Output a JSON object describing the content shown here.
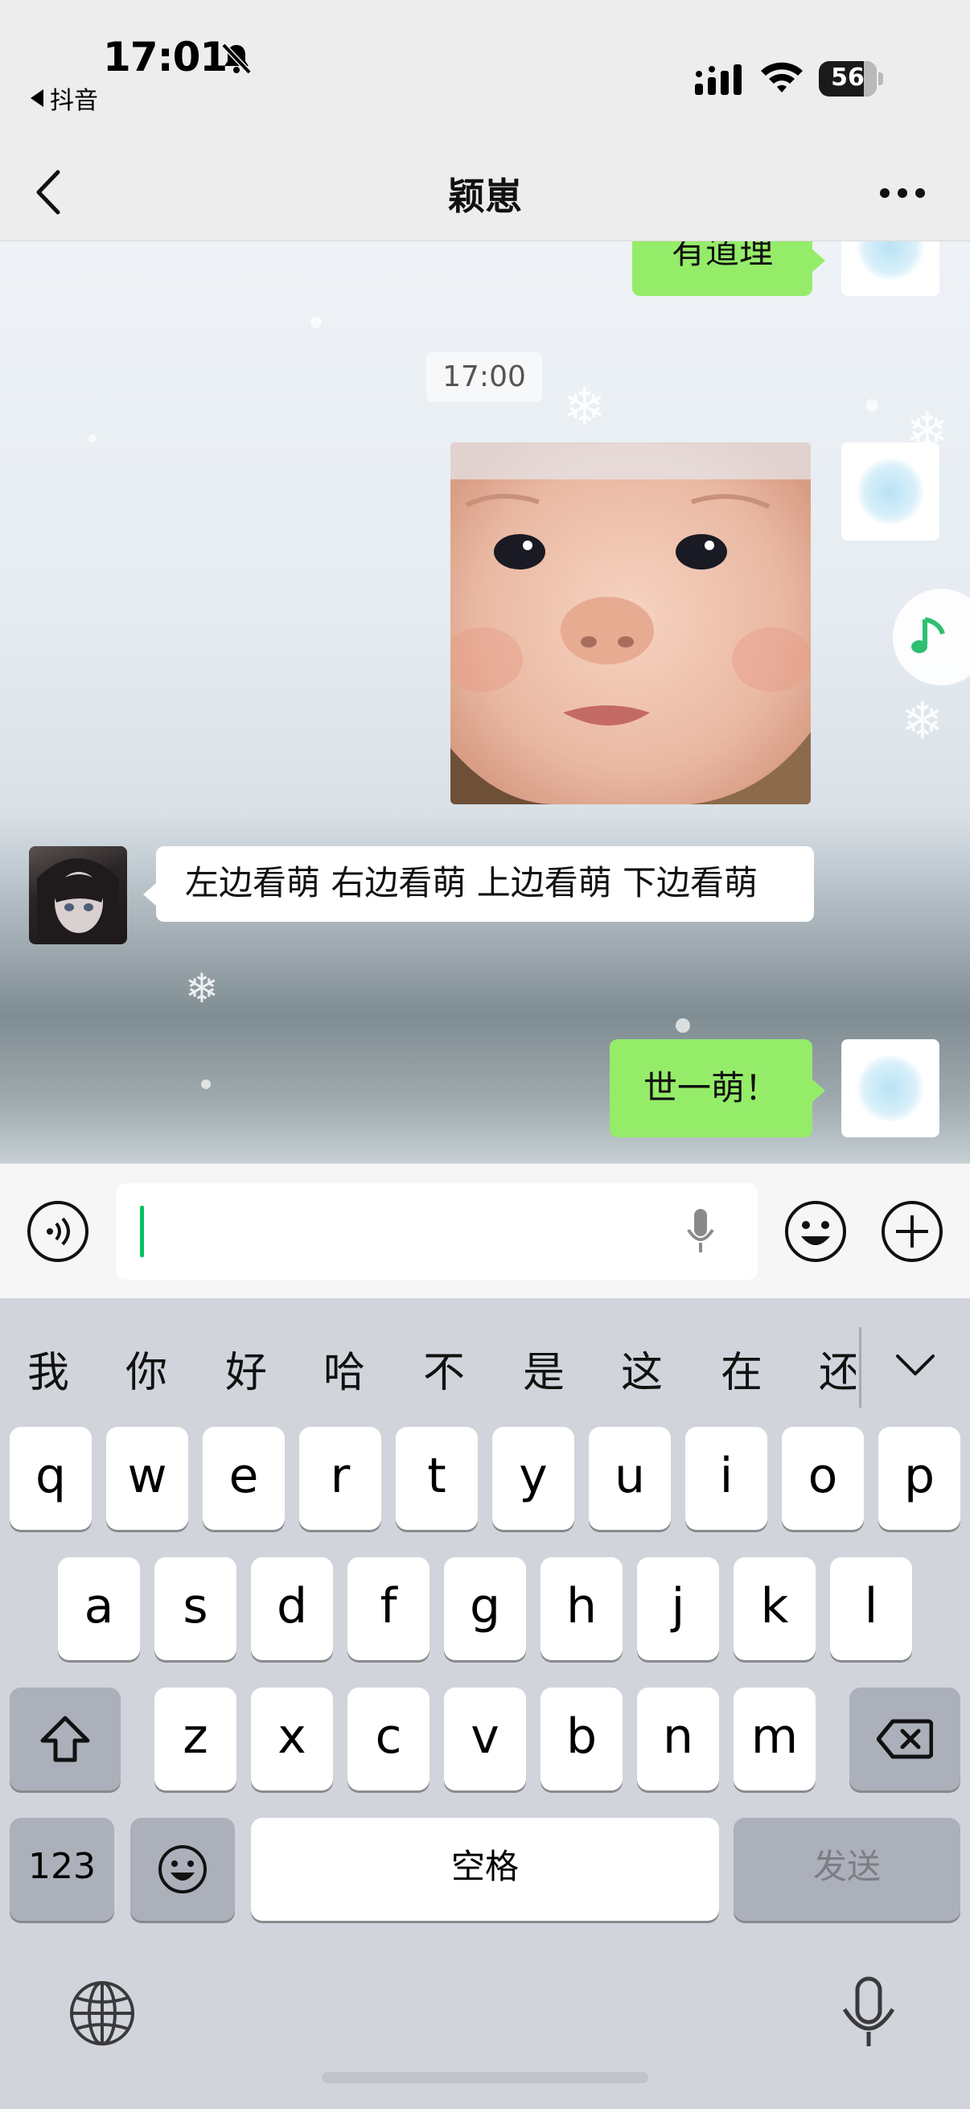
{
  "status_bar": {
    "time": "17:01",
    "back_app": "抖音",
    "battery_level": "56",
    "icons": [
      "bell-slash-icon",
      "signal-icon",
      "wifi-icon",
      "battery-icon"
    ]
  },
  "nav": {
    "title": "颖崽",
    "icons": [
      "chevron-left-icon",
      "more-icon"
    ]
  },
  "chat": {
    "partial_message": "有道理",
    "timestamp": "17:00",
    "image_message": "baby-face-photo",
    "received_message": "左边看萌 右边看萌 上边看萌 下边看萌",
    "sent_message": "世一萌！",
    "icons": [
      "music-note-icon"
    ]
  },
  "input_bar": {
    "value": "",
    "icons": [
      "voice-icon",
      "mic-icon",
      "emoji-icon",
      "plus-icon"
    ]
  },
  "keyboard": {
    "candidates": [
      "我",
      "你",
      "好",
      "哈",
      "不",
      "是",
      "这",
      "在",
      "还"
    ],
    "row1": [
      "q",
      "w",
      "e",
      "r",
      "t",
      "y",
      "u",
      "i",
      "o",
      "p"
    ],
    "row2": [
      "a",
      "s",
      "d",
      "f",
      "g",
      "h",
      "j",
      "k",
      "l"
    ],
    "row3": [
      "z",
      "x",
      "c",
      "v",
      "b",
      "n",
      "m"
    ],
    "num_key": "123",
    "space_key": "空格",
    "send_key": "发送",
    "icons": [
      "chevron-down-icon",
      "shift-icon",
      "backspace-icon",
      "emoji-key-icon",
      "globe-icon",
      "dictation-icon"
    ]
  },
  "colors": {
    "bubble_green": "#95ec69",
    "accent": "#07c160",
    "keyboard_bg": "#d1d4db"
  }
}
